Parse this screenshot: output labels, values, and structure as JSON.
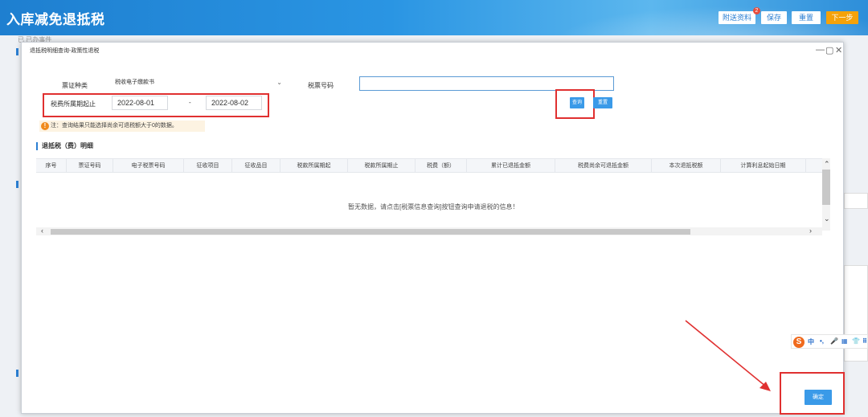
{
  "header": {
    "title": "入库减免退抵税",
    "buttons": {
      "attachments": "附送资料",
      "attachments_badge": "2",
      "save": "保存",
      "reset": "重置",
      "next": "下一步"
    }
  },
  "background": {
    "strip_text": "已 已办事件"
  },
  "modal": {
    "title": "退抵税明细查询-政策性退税",
    "controls": {
      "minimize": "—",
      "maximize": "▢",
      "close": "✕"
    },
    "form": {
      "ticket_type_label": "票证种类",
      "ticket_type_value": "税收电子缴款书",
      "ticket_number_label": "税票号码",
      "ticket_number_value": "",
      "period_label": "税费所属期起止",
      "period_start": "2022-08-01",
      "period_separator": "-",
      "period_end": "2022-08-02",
      "query_button": "查询",
      "reset_button": "重置"
    },
    "notice": "注：查询结果只能选择尚余可退税额大于0的数据。",
    "section_title": "退抵税（费）明细",
    "table": {
      "columns": [
        "序号",
        "票证号码",
        "电子税票号码",
        "征收项目",
        "征收品目",
        "税款所属期起",
        "税款所属期止",
        "税费（额）",
        "累计已退抵金额",
        "税费尚余可退抵金额",
        "本次退抵税额",
        "计算利息起始日期"
      ],
      "empty_message": "暂无数据，请点击[税票信息查询]按钮查询申请退税的信息！"
    },
    "confirm_button": "确定"
  },
  "ime": {
    "items": [
      "中",
      "•,",
      "🎤",
      "▦",
      "👕",
      "⠿"
    ]
  },
  "colors": {
    "accent_blue": "#3a9ae8",
    "highlight_red": "#e03030",
    "next_orange": "#f5a20a"
  }
}
